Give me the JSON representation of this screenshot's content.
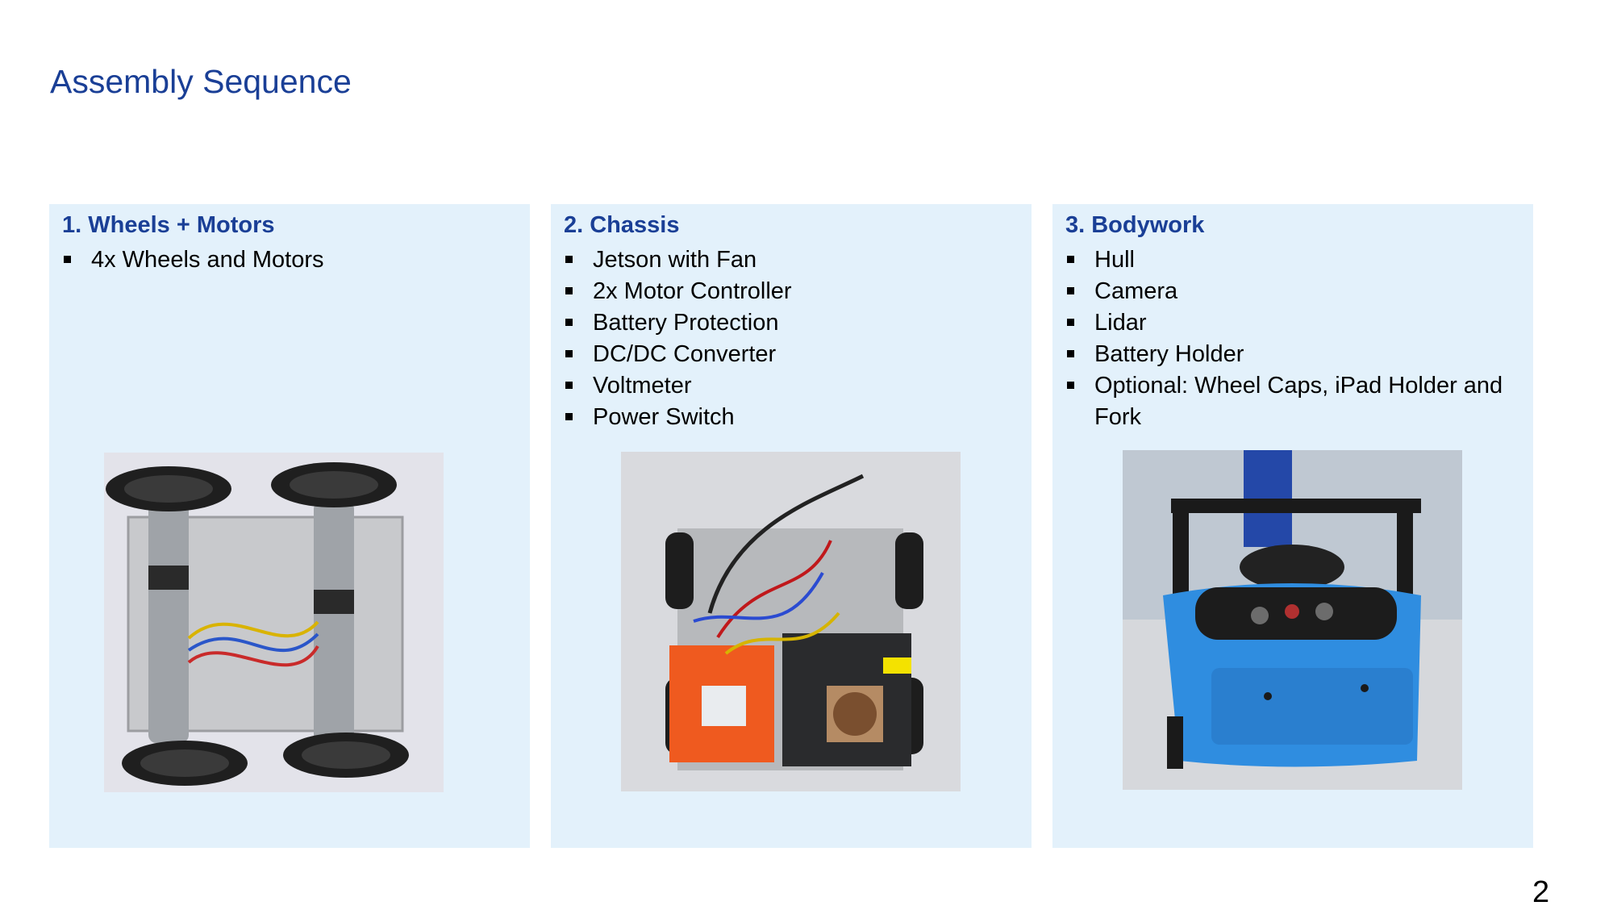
{
  "slide": {
    "title": "Assembly Sequence",
    "page_number": "2"
  },
  "panels": [
    {
      "heading": "1. Wheels + Motors",
      "items": [
        "4x Wheels and Motors"
      ]
    },
    {
      "heading": "2. Chassis",
      "items": [
        "Jetson with Fan",
        "2x Motor Controller",
        "Battery Protection",
        "DC/DC Converter",
        "Voltmeter",
        "Power Switch"
      ]
    },
    {
      "heading": "3. Bodywork",
      "items": [
        "Hull",
        "Camera",
        "Lidar",
        "Battery Holder",
        "Optional: Wheel Caps, iPad Holder and Fork"
      ]
    }
  ],
  "colors": {
    "title": "#1a3f96",
    "panel_background": "#e3f1fb",
    "robot_hull": "#2f8de0"
  }
}
